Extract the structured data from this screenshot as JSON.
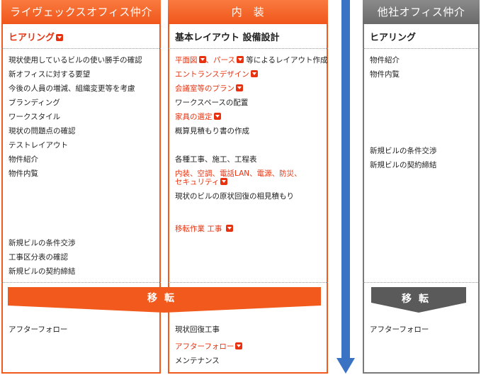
{
  "col1": {
    "header": "ライヴェックスオフィス仲介",
    "sub": "ヒアリング",
    "items": [
      "現状使用しているビルの使い勝手の確認",
      "新オフィスに対する要望",
      "今後の人員の増減、組織変更等を考慮",
      "ブランディング",
      "ワークスタイル",
      "現状の問題点の確認",
      "テストレイアウト",
      "物件紹介",
      "物件内覧"
    ],
    "items2": [
      "新規ビルの条件交渉",
      "工事区分表の確認",
      "新規ビルの契約締結"
    ],
    "after": "アフターフォロー"
  },
  "col2": {
    "header": "内　装",
    "sub": "基本レイアウト 設備設計",
    "link1a": "平面図",
    "link1b": "、パース",
    "link1c": " 等によるレイアウト作成",
    "entrance": "エントランスデザイン",
    "meeting": "会議室等のプラン",
    "workspace": "ワークスペースの配置",
    "furniture": "家具の選定",
    "estimate": "概算見積もり書の作成",
    "works": "各種工事、施工、工程表",
    "infra1": "内装、空調、電話LAN、電源、防災、",
    "infra2": "セキュリティ",
    "restore_est": "現状のビルの原状回復の相見積もり",
    "moving": "移転作業 工事",
    "restore": "現状回復工事",
    "after": "アフターフォロー",
    "maint": "メンテナンス"
  },
  "col3": {
    "header": "他社オフィス仲介",
    "sub": "ヒアリング",
    "items": [
      "物件紹介",
      "物件内覧"
    ],
    "items2": [
      "新規ビルの条件交渉",
      "新規ビルの契約締結"
    ],
    "after": "アフターフォロー"
  },
  "move": {
    "label": "移転",
    "label2": "移転"
  },
  "colors": {
    "accent": "#f25a1d",
    "link": "#e8320f",
    "gray": "#6a6a6a",
    "arrow": "#3b73c4"
  },
  "icons": [
    "dropdown-icon"
  ]
}
